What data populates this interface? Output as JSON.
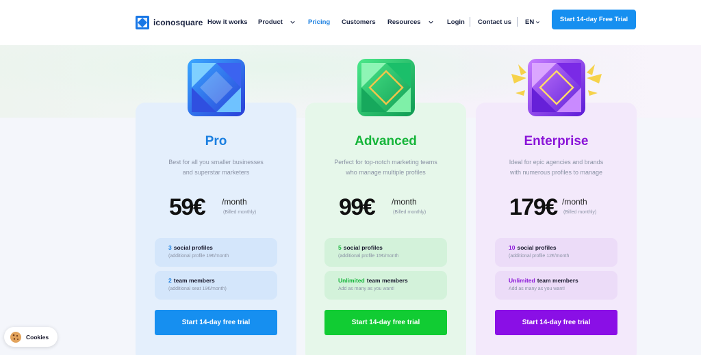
{
  "brand": {
    "name": "iconosquare"
  },
  "nav": {
    "how_it_works": "How it works",
    "product": "Product",
    "pricing": "Pricing",
    "customers": "Customers",
    "resources": "Resources",
    "login": "Login",
    "contact": "Contact us",
    "language": "EN",
    "cta": "Start 14-day Free Trial"
  },
  "colors": {
    "primary": "#168ff0",
    "pro": "#1a7fe0",
    "advanced": "#16b53a",
    "enterprise": "#8a15d8"
  },
  "plans": [
    {
      "name": "Pro",
      "desc_line1": "Best for all you smaller businesses",
      "desc_line2": "and superstar marketers",
      "price": "59€",
      "period": "/month",
      "billing": "(Billed monthly)",
      "feature1": {
        "highlight": "3",
        "title": "social profiles",
        "sub": "(additional profile 19€/month"
      },
      "feature2": {
        "highlight": "2",
        "title": "team members",
        "sub": "(additional seat 19€/month)"
      },
      "cta": "Start 14-day free trial"
    },
    {
      "name": "Advanced",
      "desc_line1": "Perfect for top-notch marketing teams",
      "desc_line2": "who manage multiple profiles",
      "price": "99€",
      "period": "/month",
      "billing": "(Billed monthly)",
      "feature1": {
        "highlight": "5",
        "title": "social profiles",
        "sub": "(additional profile 15€/month"
      },
      "feature2": {
        "highlight": "Unlimited",
        "title": "team members",
        "sub": "Add as many as you want!"
      },
      "cta": "Start 14-day free trial"
    },
    {
      "name": "Enterprise",
      "desc_line1": "Ideal for epic agencies and brands",
      "desc_line2": "with numerous profiles to manage",
      "price": "179€",
      "period": "/month",
      "billing": "(Billed monthly)",
      "feature1": {
        "highlight": "10",
        "title": "social profiles",
        "sub": "(additional profile 12€/month"
      },
      "feature2": {
        "highlight": "Unlimited",
        "title": "team members",
        "sub": "Add as many as you want!"
      },
      "cta": "Start 14-day free trial"
    }
  ],
  "cookies": {
    "label": "Cookies"
  }
}
